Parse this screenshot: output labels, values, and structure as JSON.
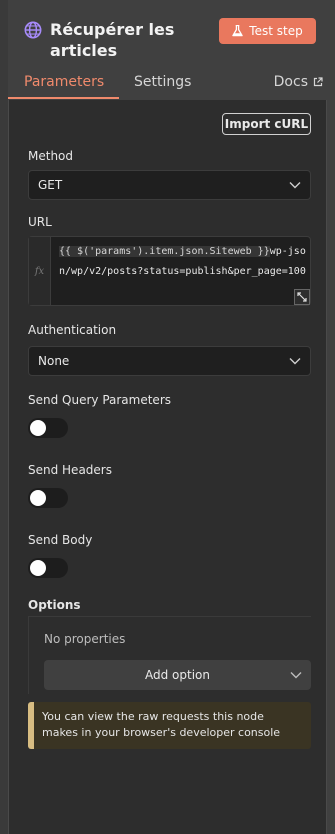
{
  "header": {
    "title": "Récupérer les articles",
    "test_step_label": "Test step",
    "icon": "globe-icon"
  },
  "tabs": [
    {
      "label": "Parameters",
      "active": true
    },
    {
      "label": "Settings",
      "active": false
    },
    {
      "label": "Docs",
      "active": false
    }
  ],
  "import_curl_label": "Import cURL",
  "method": {
    "label": "Method",
    "value": "GET"
  },
  "url": {
    "label": "URL",
    "fx": "fx",
    "expression": "{{ $('params').item.json.Siteweb }}",
    "suffix": "wp-json/wp/v2/posts?status=publish&per_page=100"
  },
  "authentication": {
    "label": "Authentication",
    "value": "None"
  },
  "send_query": {
    "label": "Send Query Parameters",
    "enabled": false
  },
  "send_headers": {
    "label": "Send Headers",
    "enabled": false
  },
  "send_body": {
    "label": "Send Body",
    "enabled": false
  },
  "options": {
    "title": "Options",
    "empty_text": "No properties",
    "add_label": "Add option"
  },
  "notice": "You can view the raw requests this node makes in your browser's developer console",
  "colors": {
    "accent": "#f08a6c",
    "test_button": "#e9785e",
    "notice_border": "#d8bd82"
  }
}
